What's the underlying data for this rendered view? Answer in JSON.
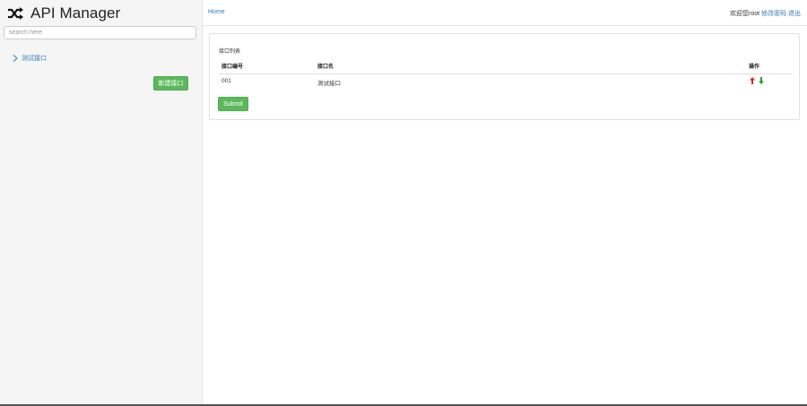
{
  "app": {
    "title": "API Manager",
    "logo_icon": "shuffle-icon"
  },
  "sidebar": {
    "search_placeholder": "search here",
    "items": [
      {
        "label": "测试接口",
        "icon": "chevron-right-icon"
      }
    ],
    "new_button_label": "新建接口"
  },
  "header": {
    "home_label": "Home",
    "welcome_text": "欢迎您root",
    "change_password_label": "修改密码",
    "logout_label": "退出"
  },
  "panel": {
    "title": "接口列表",
    "columns": [
      "接口编号",
      "接口名",
      "操作"
    ],
    "rows": [
      {
        "id": "001",
        "name": "测试接口"
      }
    ],
    "submit_label": "Submit"
  },
  "colors": {
    "accent": "#5cb85c",
    "link": "#337ab7",
    "arrow_up": "#e02020",
    "arrow_down": "#2a9a2a"
  }
}
